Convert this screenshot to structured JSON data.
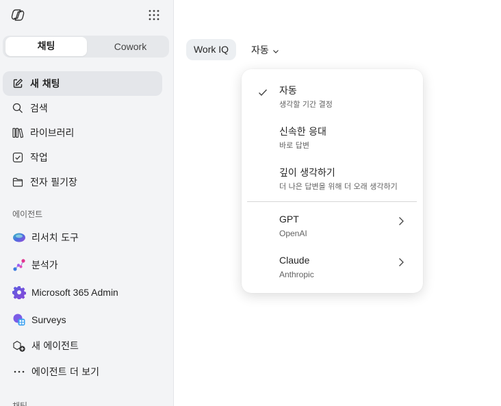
{
  "sidebar": {
    "mode_tabs": [
      "채팅",
      "Cowork"
    ],
    "nav": [
      {
        "label": "새 채팅",
        "icon": "compose-icon"
      },
      {
        "label": "검색",
        "icon": "search-icon"
      },
      {
        "label": "라이브러리",
        "icon": "library-icon"
      },
      {
        "label": "작업",
        "icon": "task-icon"
      },
      {
        "label": "전자 필기장",
        "icon": "folder-icon"
      }
    ],
    "agents_heading": "에이전트",
    "agents": [
      {
        "label": "리서치 도구",
        "icon": "researcher-icon"
      },
      {
        "label": "분석가",
        "icon": "analyst-icon"
      },
      {
        "label": "Microsoft 365 Admin",
        "icon": "admin-gear-icon"
      },
      {
        "label": "Surveys",
        "icon": "surveys-icon"
      },
      {
        "label": "새 에이전트",
        "icon": "new-agent-icon"
      },
      {
        "label": "에이전트 더 보기",
        "icon": "more-icon"
      }
    ],
    "chats_heading": "채팅"
  },
  "toolbar": {
    "chip_label": "Work IQ",
    "model_dropdown_label": "자동"
  },
  "menu": {
    "items": [
      {
        "title": "자동",
        "subtitle": "생각할 기간 결정",
        "checked": true
      },
      {
        "title": "신속한 응대",
        "subtitle": "바로 답변"
      },
      {
        "title": "깊이 생각하기",
        "subtitle": "더 나은 답변을 위해 더 오래 생각하기"
      },
      {
        "title": "GPT",
        "subtitle": "OpenAI",
        "submenu": true
      },
      {
        "title": "Claude",
        "subtitle": "Anthropic",
        "submenu": true
      }
    ]
  },
  "colors": {
    "sidebar_bg": "#f3f4f6",
    "selected_bg": "#e4e6ea",
    "chip_bg": "#eceff2"
  }
}
